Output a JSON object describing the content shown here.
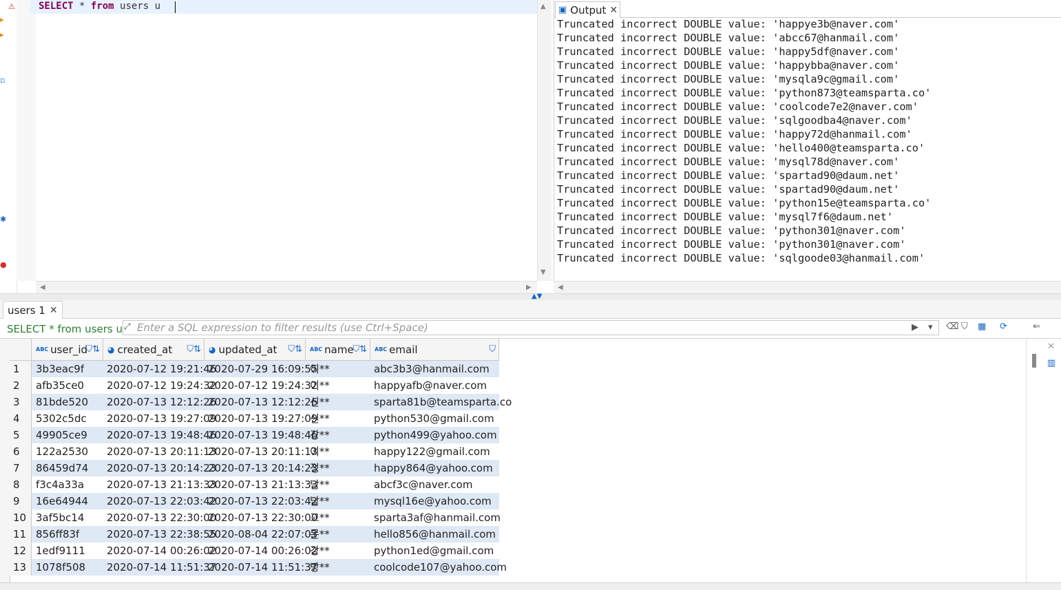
{
  "editor": {
    "sql_keyword_select": "SELECT",
    "sql_star": "*",
    "sql_keyword_from": "from",
    "sql_rest": "users u"
  },
  "output": {
    "tab_label": "Output",
    "lines": [
      "Truncated incorrect DOUBLE value: 'happye3b@naver.com'",
      "Truncated incorrect DOUBLE value: 'abcc67@hanmail.com'",
      "Truncated incorrect DOUBLE value: 'happy5df@naver.com'",
      "Truncated incorrect DOUBLE value: 'happybba@naver.com'",
      "Truncated incorrect DOUBLE value: 'mysqla9c@gmail.com'",
      "Truncated incorrect DOUBLE value: 'python873@teamsparta.co'",
      "Truncated incorrect DOUBLE value: 'coolcode7e2@naver.com'",
      "Truncated incorrect DOUBLE value: 'sqlgoodba4@naver.com'",
      "Truncated incorrect DOUBLE value: 'happy72d@hanmail.com'",
      "Truncated incorrect DOUBLE value: 'hello400@teamsparta.co'",
      "Truncated incorrect DOUBLE value: 'mysql78d@naver.com'",
      "Truncated incorrect DOUBLE value: 'spartad90@daum.net'",
      "Truncated incorrect DOUBLE value: 'spartad90@daum.net'",
      "Truncated incorrect DOUBLE value: 'python15e@teamsparta.co'",
      "Truncated incorrect DOUBLE value: 'mysql7f6@daum.net'",
      "Truncated incorrect DOUBLE value: 'python301@naver.com'",
      "Truncated incorrect DOUBLE value: 'python301@naver.com'",
      "Truncated incorrect DOUBLE value: 'sqlgoode03@hanmail.com'"
    ]
  },
  "results": {
    "tab_label": "users 1",
    "query_label": "SELECT * from users u",
    "filter_placeholder": "Enter a SQL expression to filter results (use Ctrl+Space)",
    "columns": [
      {
        "type": "ABC",
        "name": "user_id"
      },
      {
        "type": "",
        "name": "created_at"
      },
      {
        "type": "",
        "name": "updated_at"
      },
      {
        "type": "ABC",
        "name": "name"
      },
      {
        "type": "ABC",
        "name": "email"
      }
    ],
    "rows": [
      {
        "n": "1",
        "user_id": "3b3eac9f",
        "created_at": "2020-07-12 19:21:46",
        "updated_at": "2020-07-29 16:09:55",
        "name": "이**",
        "email": "abc3b3@hanmail.com"
      },
      {
        "n": "2",
        "user_id": "afb35ce0",
        "created_at": "2020-07-12 19:24:32",
        "updated_at": "2020-07-12 19:24:32",
        "name": "이**",
        "email": "happyafb@naver.com"
      },
      {
        "n": "3",
        "user_id": "81bde520",
        "created_at": "2020-07-13 12:12:26",
        "updated_at": "2020-07-13 12:12:26",
        "name": "신**",
        "email": "sparta81b@teamsparta.co"
      },
      {
        "n": "4",
        "user_id": "5302c5dc",
        "created_at": "2020-07-13 19:27:09",
        "updated_at": "2020-07-13 19:27:09",
        "name": "신**",
        "email": "python530@gmail.com"
      },
      {
        "n": "5",
        "user_id": "49905ce9",
        "created_at": "2020-07-13 19:48:46",
        "updated_at": "2020-07-13 19:48:46",
        "name": "강**",
        "email": "python499@yahoo.com"
      },
      {
        "n": "6",
        "user_id": "122a2530",
        "created_at": "2020-07-13 20:11:13",
        "updated_at": "2020-07-13 20:11:13",
        "name": "이**",
        "email": "happy122@gmail.com"
      },
      {
        "n": "7",
        "user_id": "86459d74",
        "created_at": "2020-07-13 20:14:23",
        "updated_at": "2020-07-13 20:14:23",
        "name": "정**",
        "email": "happy864@yahoo.com"
      },
      {
        "n": "8",
        "user_id": "f3c4a33a",
        "created_at": "2020-07-13 21:13:33",
        "updated_at": "2020-07-13 21:13:33",
        "name": "남**",
        "email": "abcf3c@naver.com"
      },
      {
        "n": "9",
        "user_id": "16e64944",
        "created_at": "2020-07-13 22:03:42",
        "updated_at": "2020-07-13 22:03:42",
        "name": "남**",
        "email": "mysql16e@yahoo.com"
      },
      {
        "n": "10",
        "user_id": "3af5bc14",
        "created_at": "2020-07-13 22:30:00",
        "updated_at": "2020-07-13 22:30:00",
        "name": "고**",
        "email": "sparta3af@hanmail.com"
      },
      {
        "n": "11",
        "user_id": "856ff83f",
        "created_at": "2020-07-13 22:38:55",
        "updated_at": "2020-08-04 22:07:03",
        "name": "문**",
        "email": "hello856@hanmail.com"
      },
      {
        "n": "12",
        "user_id": "1edf9111",
        "created_at": "2020-07-14 00:26:02",
        "updated_at": "2020-07-14 00:26:02",
        "name": "강**",
        "email": "python1ed@gmail.com"
      },
      {
        "n": "13",
        "user_id": "1078f508",
        "created_at": "2020-07-14 11:51:37",
        "updated_at": "2020-07-14 11:51:37",
        "name": "방**",
        "email": "coolcode107@yahoo.com"
      }
    ]
  },
  "colors": {
    "keyword": "#7f0055",
    "query_green": "#2e7d32",
    "row_alt": "#dfe8f5",
    "accent_blue": "#1565c0"
  }
}
